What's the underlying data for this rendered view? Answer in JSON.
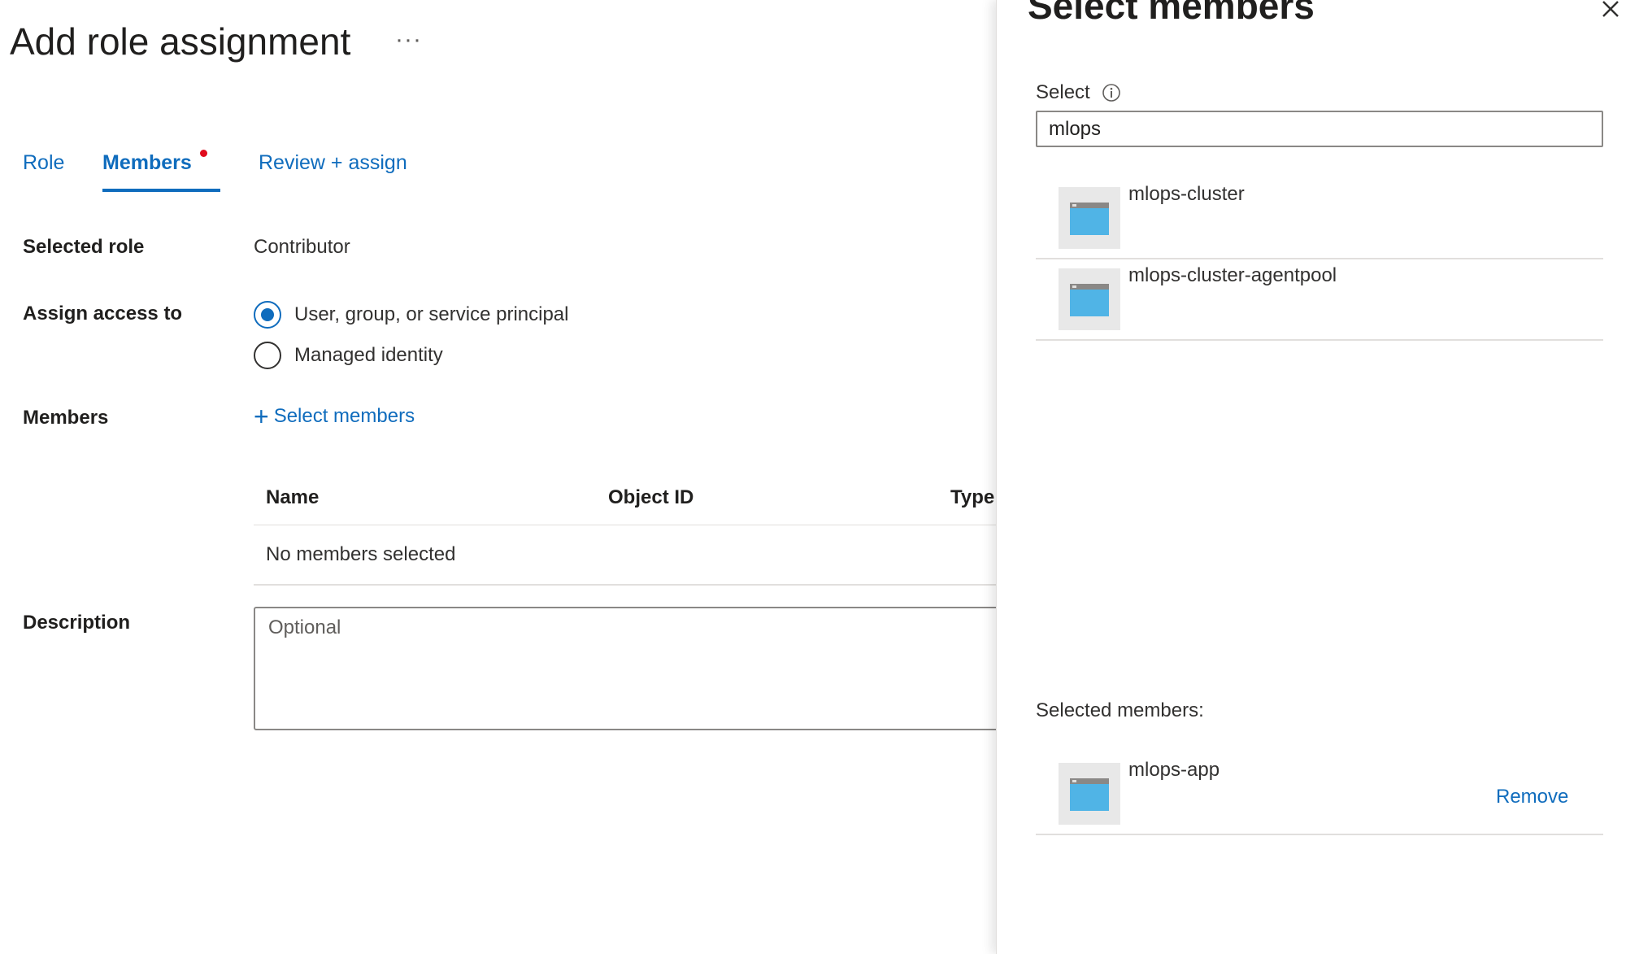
{
  "main": {
    "title": "Add role assignment",
    "more_label": "···",
    "tabs": [
      {
        "label": "Role"
      },
      {
        "label": "Members"
      },
      {
        "label": "Review + assign"
      }
    ],
    "selected_role": {
      "label": "Selected role",
      "value": "Contributor"
    },
    "assign_access": {
      "label": "Assign access to",
      "options": [
        {
          "label": "User, group, or service principal",
          "checked": true
        },
        {
          "label": "Managed identity",
          "checked": false
        }
      ]
    },
    "members": {
      "label": "Members",
      "select_link": "Select members",
      "table": {
        "columns": [
          "Name",
          "Object ID",
          "Type"
        ],
        "empty_text": "No members selected"
      }
    },
    "description": {
      "label": "Description",
      "placeholder": "Optional"
    }
  },
  "panel": {
    "title": "Select members",
    "select_label": "Select",
    "search_value": "mlops",
    "results": [
      {
        "name": "mlops-cluster"
      },
      {
        "name": "mlops-cluster-agentpool"
      }
    ],
    "selected_label": "Selected members:",
    "selected": [
      {
        "name": "mlops-app",
        "remove_label": "Remove"
      }
    ]
  },
  "colors": {
    "accent": "#0f6cbd",
    "required_dot": "#e00b1c",
    "app_icon": "#50b4e6"
  }
}
